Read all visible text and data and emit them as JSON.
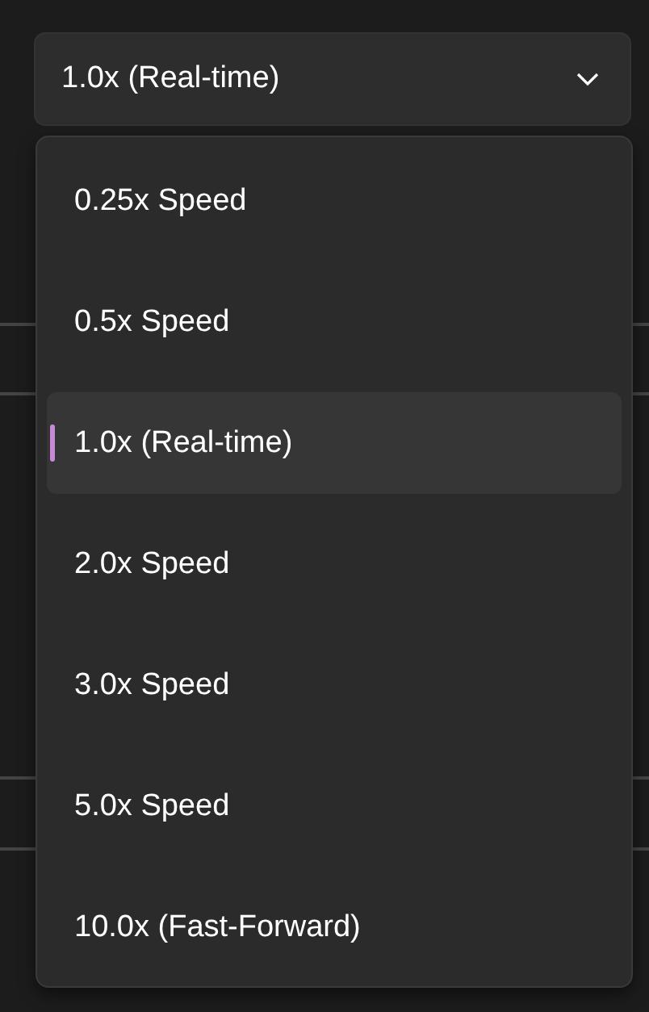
{
  "speed_select": {
    "value": "1.0x (Real-time)",
    "expanded": true
  },
  "options": [
    {
      "label": "0.25x Speed",
      "selected": false
    },
    {
      "label": "0.5x Speed",
      "selected": false
    },
    {
      "label": "1.0x (Real-time)",
      "selected": true
    },
    {
      "label": "2.0x Speed",
      "selected": false
    },
    {
      "label": "3.0x Speed",
      "selected": false
    },
    {
      "label": "5.0x Speed",
      "selected": false
    },
    {
      "label": "10.0x (Fast-Forward)",
      "selected": false
    }
  ]
}
